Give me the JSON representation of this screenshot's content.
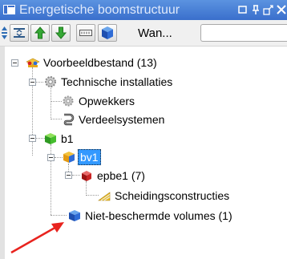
{
  "window": {
    "title": "Energetische boomstructuur"
  },
  "toolbar": {
    "wan_label": "Wan...",
    "filter_value": ""
  },
  "tree": {
    "root": "Voorbeeldbestand (13)",
    "tech": "Technische installaties",
    "opwekkers": "Opwekkers",
    "verdeel": "Verdeelsystemen",
    "b1": "b1",
    "bv1": "bv1",
    "epbe1": "epbe1 (7)",
    "scheiding": "Scheidingsconstructies",
    "nietbeschermd": "Niet-beschermde volumes (1)"
  },
  "colors": {
    "titlebar": "#3a6fcc",
    "selection": "#3399ff",
    "arrow": "#e8231e"
  }
}
